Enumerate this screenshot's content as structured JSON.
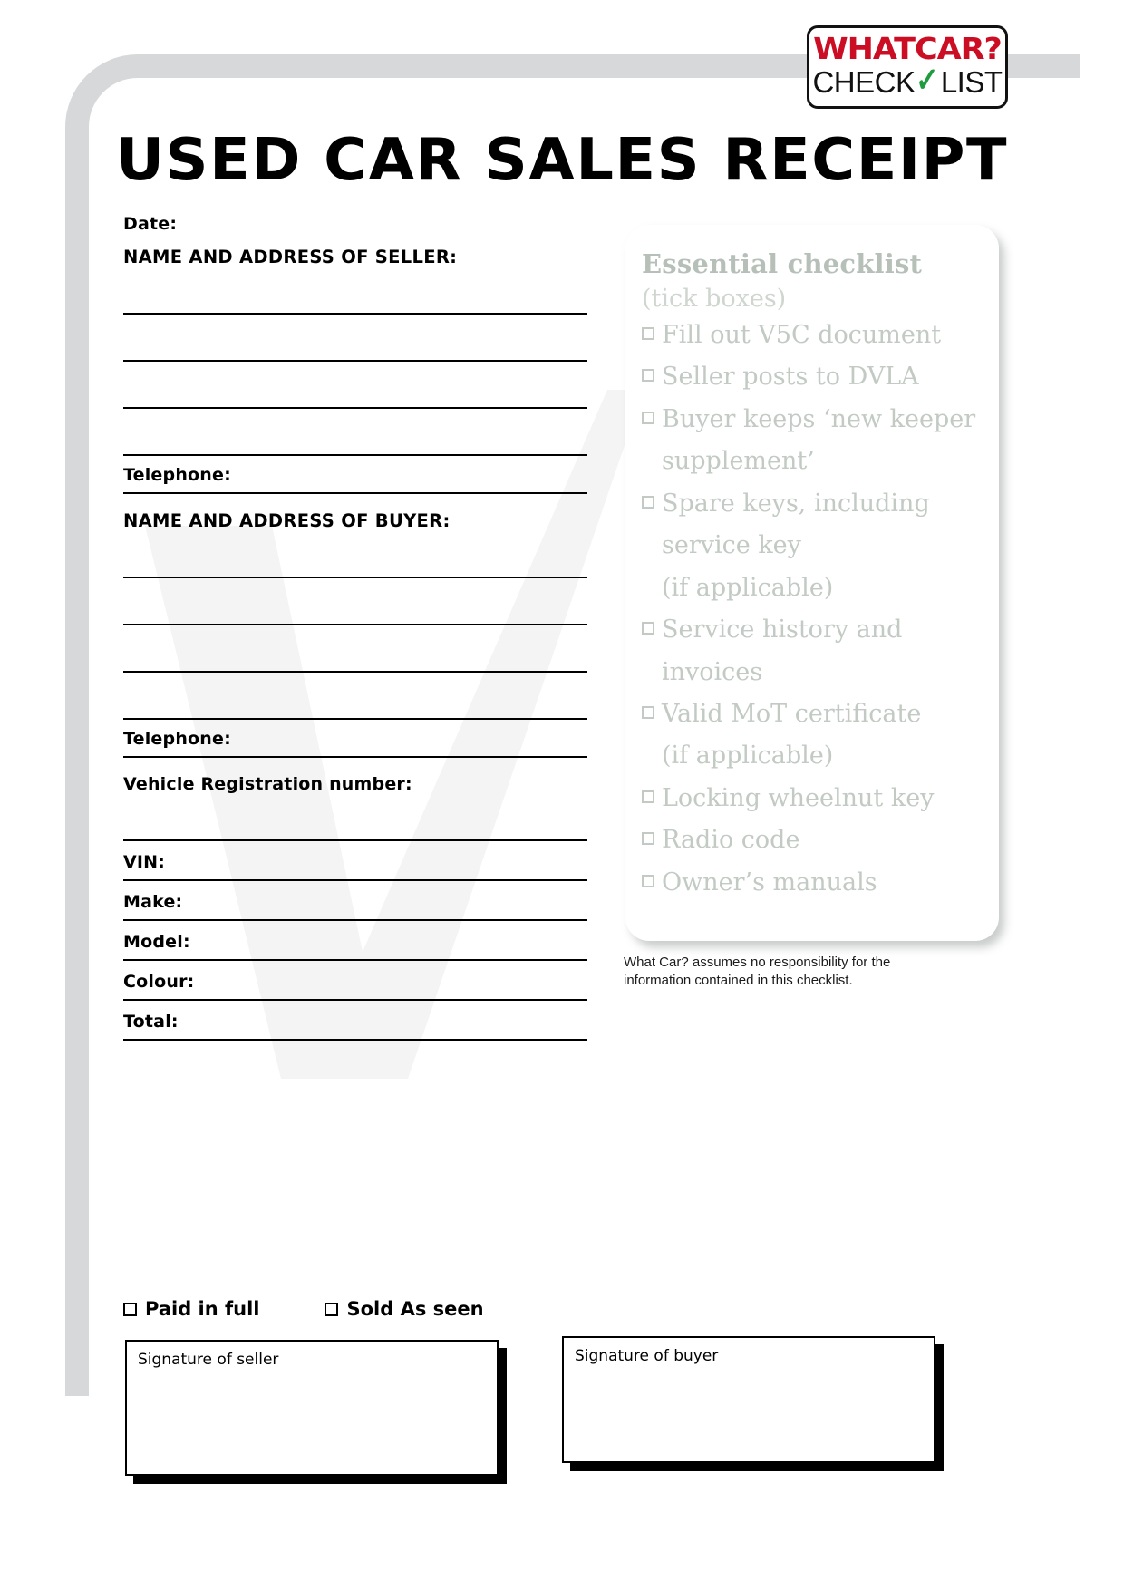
{
  "logo": {
    "top_text": "WHATCAR?",
    "bottom_left": "CHECK",
    "check_glyph": "✓",
    "bottom_right": "LIST",
    "red": "#cc0e25",
    "green": "#1f9c3d"
  },
  "title": "USED CAR SALES RECEIPT",
  "form": {
    "date_label": "Date:",
    "seller_heading": "NAME AND ADDRESS OF SELLER:",
    "seller_telephone_label": "Telephone:",
    "buyer_heading": "NAME AND ADDRESS OF BUYER:",
    "buyer_telephone_label": "Telephone:",
    "vrn_label": "Vehicle Registration number:",
    "vin_label": "VIN:",
    "make_label": "Make:",
    "model_label": "Model:",
    "colour_label": "Colour:",
    "total_label": "Total:"
  },
  "payment_options": [
    {
      "label": "Paid in full"
    },
    {
      "label": "Sold As seen"
    }
  ],
  "signatures": {
    "seller_label": "Signature of seller",
    "buyer_label": "Signature of buyer"
  },
  "checklist": {
    "title": "Essential checklist",
    "subtitle": "(tick boxes)",
    "items": [
      "Fill out V5C document",
      "Seller posts to DVLA",
      "Buyer keeps ‘new keeper\nsupplement’",
      "Spare keys, including\nservice key\n(if applicable)",
      "Service history and\ninvoices",
      "Valid MoT certificate\n(if applicable)",
      "Locking wheelnut key",
      "Radio code",
      "Owner’s manuals"
    ],
    "title_color": "#b6c0b8",
    "text_color": "#c2cac3"
  },
  "disclaimer": "What Car? assumes no responsibility for the information contained in this checklist."
}
